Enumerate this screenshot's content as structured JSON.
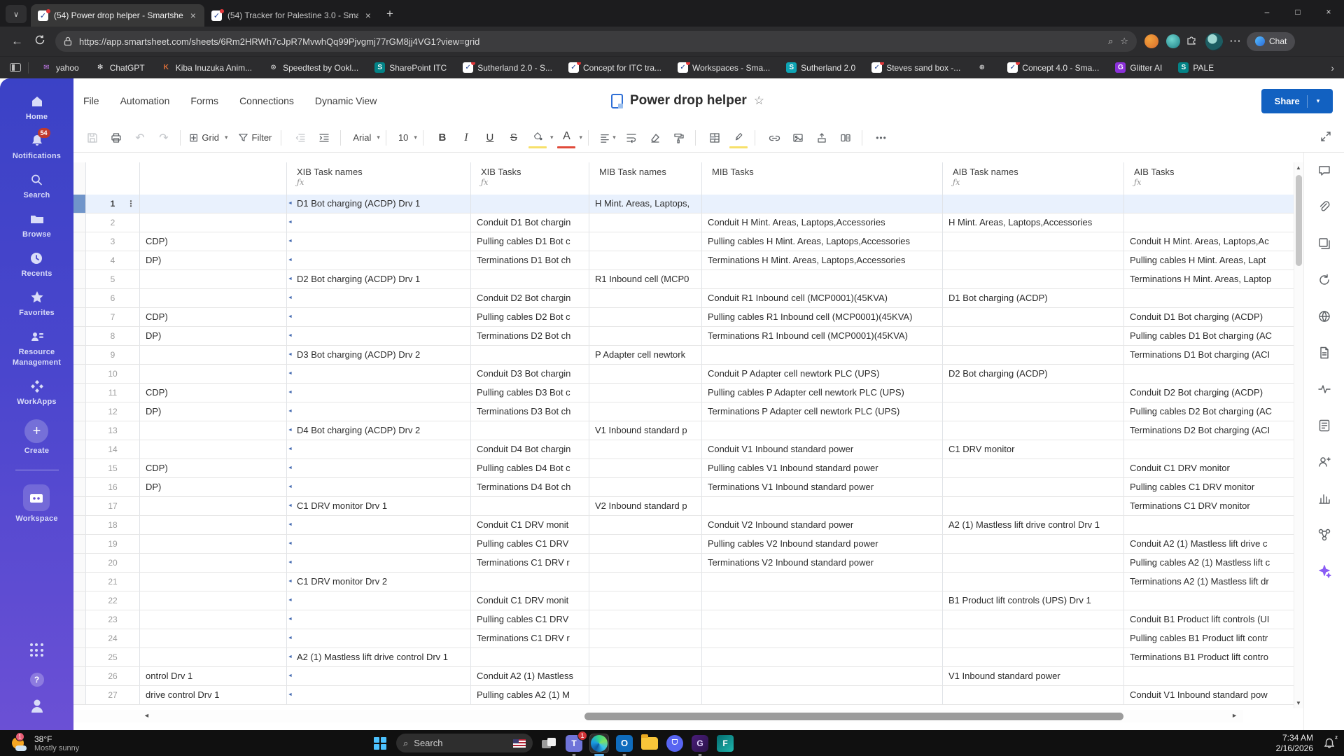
{
  "glyphs": {
    "caret": "▾",
    "close": "×",
    "plus": "+",
    "back": "←",
    "star": "☆",
    "dots_v": "⋮",
    "dots_h": "•••",
    "flag": "◄",
    "min": "–",
    "max": "□",
    "chev_down": "∨",
    "chev_right": "›",
    "undo": "↶",
    "redo": "↷",
    "grid": "⊞",
    "up": "▲",
    "down": "▼",
    "left": "◄",
    "right": "►",
    "help": "?",
    "zz": "z",
    "ellipsis": "⋯",
    "mag": "⌕"
  },
  "browser": {
    "tabs": [
      {
        "title": "(54) Power drop helper - Smartshe"
      },
      {
        "title": "(54) Tracker for Palestine 3.0 - Sma"
      }
    ],
    "url": "https://app.smartsheet.com/sheets/6Rm2HRWh7cJpR7MvwhQq99Pjvgmj77rGM8jj4VG1?view=grid",
    "chat_label": "Chat",
    "bookmarks": [
      {
        "label": "yahoo",
        "glyph": "✉",
        "fg": "#c77df0"
      },
      {
        "label": "ChatGPT",
        "glyph": "✻",
        "fg": "#e8e8e8"
      },
      {
        "label": "Kiba Inuzuka Anim...",
        "glyph": "K",
        "fg": "#e07038"
      },
      {
        "label": "Speedtest by Ookl...",
        "glyph": "⊙",
        "fg": "#d8d8d8"
      },
      {
        "label": "SharePoint ITC",
        "glyph": "S",
        "bg": "#038387",
        "fg": "#ffffff"
      },
      {
        "label": "Sutherland 2.0 - S...",
        "glyph": "✓",
        "bg": "#ffffff",
        "fg": "#1f3e92",
        "dot": true
      },
      {
        "label": "Concept for ITC tra...",
        "glyph": "✓",
        "bg": "#ffffff",
        "fg": "#1f3e92",
        "dot": true
      },
      {
        "label": "Workspaces - Sma...",
        "glyph": "✓",
        "bg": "#ffffff",
        "fg": "#1f3e92",
        "dot": true
      },
      {
        "label": "Sutherland 2.0",
        "glyph": "S",
        "bg": "#0ea5b5",
        "fg": "#ffffff"
      },
      {
        "label": "Steves sand box -...",
        "glyph": "✓",
        "bg": "#ffffff",
        "fg": "#1f3e92",
        "dot": true
      },
      {
        "label": "",
        "glyph": "⊕",
        "fg": "#cfcfcf"
      },
      {
        "label": "Concept 4.0 - Sma...",
        "glyph": "✓",
        "bg": "#ffffff",
        "fg": "#1f3e92",
        "dot": true
      },
      {
        "label": "Glitter AI",
        "glyph": "G",
        "bg": "#8b30d9",
        "fg": "#ffffff"
      },
      {
        "label": "PALE",
        "glyph": "S",
        "bg": "#038387",
        "fg": "#ffffff"
      }
    ]
  },
  "sidebar": {
    "notifications_badge": "54",
    "items": {
      "home": "Home",
      "notifications": "Notifications",
      "search": "Search",
      "browse": "Browse",
      "recents": "Recents",
      "favorites": "Favorites",
      "resource1": "Resource",
      "resource2": "Management",
      "workapps": "WorkApps",
      "create": "Create",
      "workspace": "Workspace"
    }
  },
  "app": {
    "menu": [
      "File",
      "Automation",
      "Forms",
      "Connections",
      "Dynamic View"
    ],
    "title": "Power drop helper",
    "share_label": "Share",
    "toolbar": {
      "view_label": "Grid",
      "filter_label": "Filter",
      "font_name": "Arial",
      "font_size": "10",
      "bold": "B",
      "italic": "I",
      "underline": "U",
      "strikethrough": "S",
      "text_color": "A"
    }
  },
  "grid": {
    "headers": [
      {
        "label": "XIB Task names",
        "fx": "ƒx"
      },
      {
        "label": "XIB Tasks",
        "fx": "ƒx"
      },
      {
        "label": "MIB Task names",
        "fx": ""
      },
      {
        "label": "MIB Tasks",
        "fx": ""
      },
      {
        "label": "AIB Task names",
        "fx": "ƒx"
      },
      {
        "label": "AIB Tasks",
        "fx": "ƒx"
      }
    ],
    "rows": [
      {
        "n": "1",
        "a": "",
        "xn": "D1 Bot charging (ACDP) Drv 1",
        "xt": "",
        "mn": "H Mint. Areas, Laptops,",
        "mt": "",
        "an": "",
        "at": "",
        "cls": "sel"
      },
      {
        "n": "2",
        "a": "",
        "xn": "",
        "xt": "Conduit D1 Bot chargin",
        "mn": "",
        "mt": "Conduit H Mint. Areas, Laptops,Accessories",
        "an": "H Mint. Areas, Laptops,Accessories",
        "at": ""
      },
      {
        "n": "3",
        "a": "CDP)",
        "xn": "",
        "xt": "Pulling cables D1 Bot c",
        "mn": "",
        "mt": "Pulling cables H Mint. Areas, Laptops,Accessories",
        "an": "",
        "at": "Conduit H Mint. Areas, Laptops,Ac"
      },
      {
        "n": "4",
        "a": "DP)",
        "xn": "",
        "xt": "Terminations D1 Bot ch",
        "mn": "",
        "mt": "Terminations H Mint. Areas, Laptops,Accessories",
        "an": "",
        "at": "Pulling cables H Mint. Areas, Lapt"
      },
      {
        "n": "5",
        "a": "",
        "xn": "D2 Bot charging (ACDP) Drv 1",
        "xt": "",
        "mn": "R1 Inbound cell (MCP0",
        "mt": "",
        "an": "",
        "at": "Terminations H Mint. Areas, Laptop"
      },
      {
        "n": "6",
        "a": "",
        "xn": "",
        "xt": "Conduit D2 Bot chargin",
        "mn": "",
        "mt": "Conduit R1 Inbound cell (MCP0001)(45KVA)",
        "an": "D1 Bot charging (ACDP)",
        "at": ""
      },
      {
        "n": "7",
        "a": "CDP)",
        "xn": "",
        "xt": "Pulling cables D2 Bot c",
        "mn": "",
        "mt": "Pulling cables R1 Inbound cell (MCP0001)(45KVA)",
        "an": "",
        "at": "Conduit D1 Bot charging (ACDP)"
      },
      {
        "n": "8",
        "a": "DP)",
        "xn": "",
        "xt": "Terminations D2 Bot ch",
        "mn": "",
        "mt": "Terminations R1 Inbound cell (MCP0001)(45KVA)",
        "an": "",
        "at": "Pulling cables D1 Bot charging (AC"
      },
      {
        "n": "9",
        "a": "",
        "xn": "D3 Bot charging (ACDP) Drv 2",
        "xt": "",
        "mn": "P Adapter cell newtork",
        "mt": "",
        "an": "",
        "at": "Terminations D1 Bot charging (ACI"
      },
      {
        "n": "10",
        "a": "",
        "xn": "",
        "xt": "Conduit D3 Bot chargin",
        "mn": "",
        "mt": "Conduit P Adapter cell newtork PLC (UPS)",
        "an": "D2 Bot charging (ACDP)",
        "at": ""
      },
      {
        "n": "11",
        "a": "CDP)",
        "xn": "",
        "xt": "Pulling cables D3 Bot c",
        "mn": "",
        "mt": "Pulling cables P Adapter cell newtork PLC (UPS)",
        "an": "",
        "at": "Conduit D2 Bot charging (ACDP)"
      },
      {
        "n": "12",
        "a": "DP)",
        "xn": "",
        "xt": "Terminations D3 Bot ch",
        "mn": "",
        "mt": "Terminations P Adapter cell newtork PLC (UPS)",
        "an": "",
        "at": "Pulling cables D2 Bot charging (AC"
      },
      {
        "n": "13",
        "a": "",
        "xn": "D4 Bot charging (ACDP) Drv 2",
        "xt": "",
        "mn": "V1 Inbound standard p",
        "mt": "",
        "an": "",
        "at": "Terminations D2 Bot charging (ACI"
      },
      {
        "n": "14",
        "a": "",
        "xn": "",
        "xt": "Conduit D4 Bot chargin",
        "mn": "",
        "mt": "Conduit V1 Inbound standard power",
        "an": "C1 DRV monitor",
        "at": ""
      },
      {
        "n": "15",
        "a": "CDP)",
        "xn": "",
        "xt": "Pulling cables D4 Bot c",
        "mn": "",
        "mt": "Pulling cables V1 Inbound standard power",
        "an": "",
        "at": "Conduit C1 DRV monitor"
      },
      {
        "n": "16",
        "a": "DP)",
        "xn": "",
        "xt": "Terminations D4 Bot ch",
        "mn": "",
        "mt": "Terminations V1 Inbound standard power",
        "an": "",
        "at": "Pulling cables C1 DRV monitor"
      },
      {
        "n": "17",
        "a": "",
        "xn": "C1 DRV monitor Drv 1",
        "xt": "",
        "mn": "V2 Inbound standard p",
        "mt": "",
        "an": "",
        "at": "Terminations C1 DRV monitor"
      },
      {
        "n": "18",
        "a": "",
        "xn": "",
        "xt": "Conduit C1 DRV monit",
        "mn": "",
        "mt": "Conduit V2 Inbound standard power",
        "an": "A2 (1) Mastless lift drive control Drv 1",
        "at": ""
      },
      {
        "n": "19",
        "a": "",
        "xn": "",
        "xt": "Pulling cables C1 DRV",
        "mn": "",
        "mt": "Pulling cables V2 Inbound standard power",
        "an": "",
        "at": "Conduit A2 (1) Mastless lift drive c"
      },
      {
        "n": "20",
        "a": "",
        "xn": "",
        "xt": "Terminations C1 DRV r",
        "mn": "",
        "mt": "Terminations V2 Inbound standard power",
        "an": "",
        "at": "Pulling cables A2 (1) Mastless lift c"
      },
      {
        "n": "21",
        "a": "",
        "xn": "C1 DRV monitor Drv 2",
        "xt": "",
        "mn": "",
        "mt": "",
        "an": "",
        "at": "Terminations A2 (1) Mastless lift dr"
      },
      {
        "n": "22",
        "a": "",
        "xn": "",
        "xt": "Conduit C1 DRV monit",
        "mn": "",
        "mt": "",
        "an": "B1 Product lift controls (UPS) Drv 1",
        "at": ""
      },
      {
        "n": "23",
        "a": "",
        "xn": "",
        "xt": "Pulling cables C1 DRV",
        "mn": "",
        "mt": "",
        "an": "",
        "at": "Conduit B1 Product lift controls (UI"
      },
      {
        "n": "24",
        "a": "",
        "xn": "",
        "xt": "Terminations C1 DRV r",
        "mn": "",
        "mt": "",
        "an": "",
        "at": "Pulling cables B1 Product lift contr"
      },
      {
        "n": "25",
        "a": "",
        "xn": "A2 (1) Mastless lift drive control Drv 1",
        "xt": "",
        "mn": "",
        "mt": "",
        "an": "",
        "at": "Terminations B1 Product lift contro"
      },
      {
        "n": "26",
        "a": "ontrol Drv 1",
        "xn": "",
        "xt": "Conduit A2 (1) Mastless",
        "mn": "",
        "mt": "",
        "an": "V1 Inbound standard power",
        "at": ""
      },
      {
        "n": "27",
        "a": "drive control Drv 1",
        "xn": "",
        "xt": "Pulling cables A2 (1) M",
        "mn": "",
        "mt": "",
        "an": "",
        "at": "Conduit V1 Inbound standard pow"
      }
    ]
  },
  "rail": {
    "icons": [
      "comments",
      "attachments",
      "proofs",
      "update-requests",
      "publish",
      "create-form",
      "activity-log",
      "summary",
      "contacts",
      "charts",
      "connections",
      "ai-assistant"
    ]
  },
  "taskbar": {
    "weather_temp": "38°F",
    "weather_desc": "Mostly sunny",
    "weather_badge": "1",
    "search_placeholder": "Search",
    "teams_badge": "1",
    "time": "7:34 AM",
    "date": "2/16/2026"
  }
}
